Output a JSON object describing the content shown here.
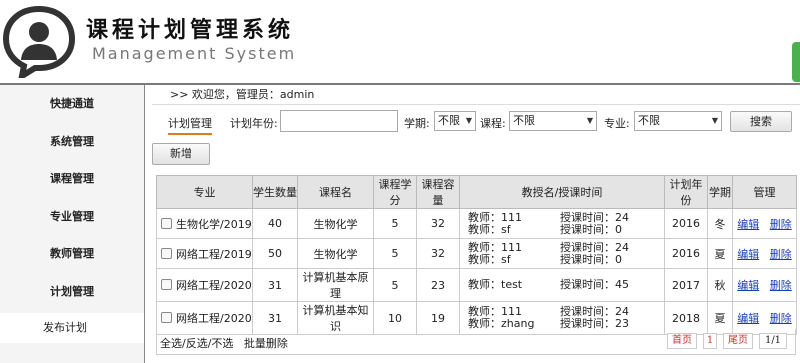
{
  "header": {
    "title_cn": "课程计划管理系统",
    "title_en": "Management System",
    "logo_icon": "person-speech-bubble-icon"
  },
  "sidebar": {
    "items": [
      {
        "label": "快捷通道"
      },
      {
        "label": "系统管理"
      },
      {
        "label": "课程管理"
      },
      {
        "label": "专业管理"
      },
      {
        "label": "教师管理"
      },
      {
        "label": "计划管理"
      }
    ],
    "sub_item": "发布计划"
  },
  "breadcrumb": ">> 欢迎您，管理员：admin",
  "filters": {
    "tab_label": "计划管理",
    "year_label": "计划年份:",
    "year_value": "",
    "term_label": "学期:",
    "term_value": "不限",
    "course_label": "课程:",
    "course_value": "不限",
    "major_label": "专业:",
    "major_value": "不限",
    "search_label": "搜索"
  },
  "add_label": "新增",
  "table": {
    "headers": [
      "专业",
      "学生数量",
      "课程名",
      "课程学分",
      "课程容量",
      "教授名/授课时间",
      "计划年份",
      "学期",
      "管理"
    ],
    "rows": [
      {
        "major": "生物化学/2019",
        "students": "40",
        "course": "生物化学",
        "credit": "5",
        "capacity": "32",
        "teachers": [
          {
            "t": "教师：111",
            "h": "授课时间：24"
          },
          {
            "t": "教师：sf",
            "h": "授课时间：0"
          }
        ],
        "year": "2016",
        "term": "冬",
        "edit": "编辑",
        "del": "删除"
      },
      {
        "major": "网络工程/2019",
        "students": "50",
        "course": "生物化学",
        "credit": "5",
        "capacity": "32",
        "teachers": [
          {
            "t": "教师：111",
            "h": "授课时间：24"
          },
          {
            "t": "教师：sf",
            "h": "授课时间：0"
          }
        ],
        "year": "2016",
        "term": "夏",
        "edit": "编辑",
        "del": "删除"
      },
      {
        "major": "网络工程/2020",
        "students": "31",
        "course": "计算机基本原理",
        "credit": "5",
        "capacity": "23",
        "teachers": [
          {
            "t": "教师：test",
            "h": "授课时间：45"
          }
        ],
        "year": "2017",
        "term": "秋",
        "edit": "编辑",
        "del": "删除"
      },
      {
        "major": "网络工程/2020",
        "students": "31",
        "course": "计算机基本知识",
        "credit": "10",
        "capacity": "19",
        "teachers": [
          {
            "t": "教师：111",
            "h": "授课时间：24"
          },
          {
            "t": "教师：zhang",
            "h": "授课时间：23"
          }
        ],
        "year": "2018",
        "term": "夏",
        "edit": "编辑",
        "del": "删除"
      }
    ]
  },
  "footer": {
    "select_all": "全选/反选/不选",
    "batch_delete": "批量删除",
    "first_page": "首页",
    "current_page": "1",
    "last_page": "尾页",
    "page_count": "1/1"
  },
  "colors": {
    "accent": "#e07a1a",
    "link": "#1a3fb5",
    "header_rule": "#7a7a7a"
  }
}
